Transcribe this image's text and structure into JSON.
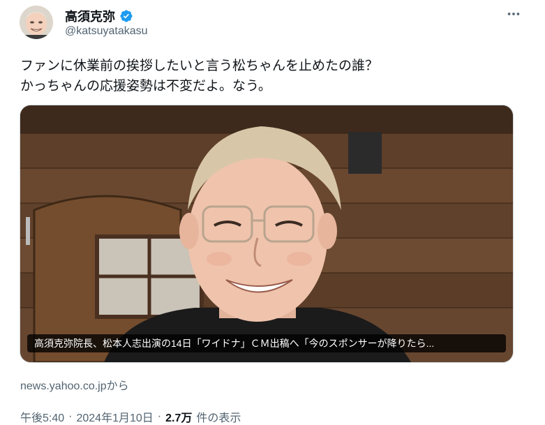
{
  "author": {
    "display_name": "高須克弥",
    "handle": "@katsuyatakasu",
    "verified_color": "#1d9bf0"
  },
  "tweet": {
    "line1": "ファンに休業前の挨拶したいと言う松ちゃんを止めたの誰？",
    "line2": "かっちゃんの応援姿勢は不変だよ。なう。"
  },
  "media": {
    "caption": "高須克弥院長、松本人志出演の14日「ワイドナ」ＣＭ出稿へ「今のスポンサーが降りたら..."
  },
  "link_source": "news.yahoo.co.jpから",
  "meta": {
    "time": "午後5:40",
    "sep1": "·",
    "date": "2024年1月10日",
    "sep2": "·",
    "views_count": "2.7万",
    "views_label": "件の表示"
  },
  "icons": {
    "more": "more-horizontal-icon",
    "verified": "verified-badge-icon"
  }
}
